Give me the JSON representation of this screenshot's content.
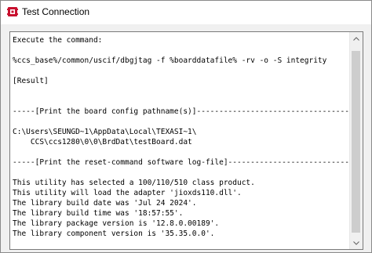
{
  "window": {
    "title": "Test Connection",
    "icon": "app-icon-red-chip"
  },
  "output": {
    "lines": [
      "Execute the command:",
      "",
      "%ccs_base%/common/uscif/dbgjtag -f %boarddatafile% -rv -o -S integrity",
      "",
      "[Result]",
      "",
      "",
      "-----[Print the board config pathname(s)]------------------------------------",
      "",
      "C:\\Users\\SEUNGD~1\\AppData\\Local\\TEXASI~1\\",
      "    CCS\\ccs1280\\0\\0\\BrdDat\\testBoard.dat",
      "",
      "-----[Print the reset-command software log-file]-----------------------------",
      "",
      "This utility has selected a 100/110/510 class product.",
      "This utility will load the adapter 'jioxds110.dll'.",
      "The library build date was 'Jul 24 2024'.",
      "The library build time was '18:57:55'.",
      "The library package version is '12.8.0.00189'.",
      "The library component version is '35.35.0.0'."
    ]
  },
  "scrollbar": {
    "up_icon": "scroll-up-arrow-icon",
    "down_icon": "scroll-down-arrow-icon"
  }
}
